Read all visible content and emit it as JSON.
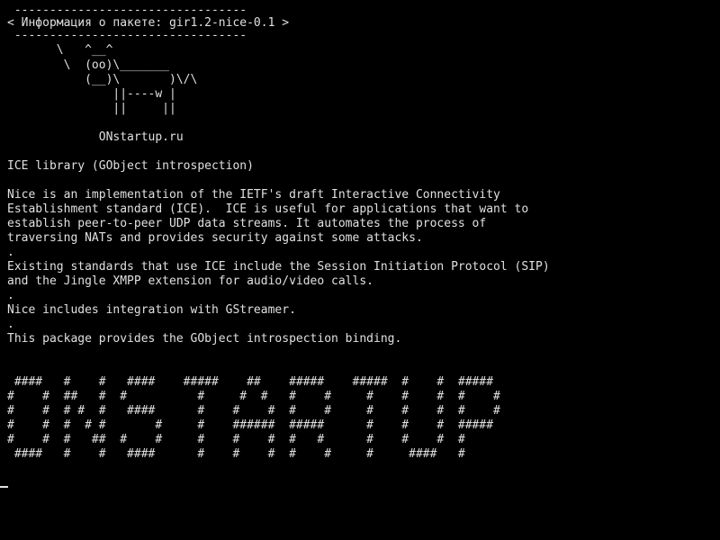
{
  "screen": {
    "cowsay": {
      "bubble_top": " ---------------------------------",
      "bubble_text": "< Информация о пакете: gir1.2-nice-0.1 >",
      "bubble_bottom": " ---------------------------------",
      "cow_lines": [
        "       \\   ^__^",
        "        \\  (oo)\\_______",
        "           (__)\\       )\\/\\",
        "               ||----w |",
        "               ||     ||"
      ]
    },
    "site": "             ONstartup.ru",
    "package_summary": "ICE library (GObject introspection)",
    "description_lines": [
      "Nice is an implementation of the IETF's draft Interactive Connectivity",
      "Establishment standard (ICE).  ICE is useful for applications that want to",
      "establish peer-to-peer UDP data streams. It automates the process of",
      "traversing NATs and provides security against some attacks.",
      ".",
      "Existing standards that use ICE include the Session Initiation Protocol (SIP)",
      "and the Jingle XMPP extension for audio/video calls.",
      ".",
      "Nice includes integration with GStreamer.",
      ".",
      "This package provides the GObject introspection binding."
    ],
    "banner_lines": [
      " ####   #    #   ####    #####    ##    #####    #####  #    #  #####",
      "#    #  ##   #  #          #     #  #   #    #     #    #    #  #    #",
      "#    #  # #  #   ####      #    #    #  #    #     #    #    #  #    #",
      "#    #  #  # #       #     #    ######  #####      #    #    #  #####",
      "#    #  #   ##  #    #     #    #    #  #   #      #    #    #  #",
      " ####   #    #   ####      #    #    #  #    #     #     ####   #"
    ]
  }
}
